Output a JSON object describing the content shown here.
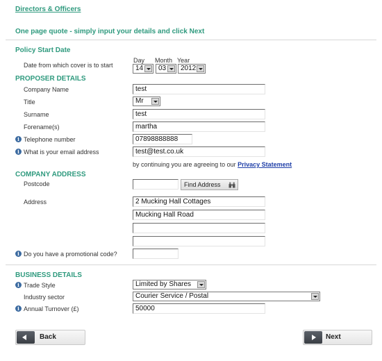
{
  "header": {
    "breadcrumb_link": "Directors & Officers",
    "intro": "One page quote - simply input your details and click Next"
  },
  "policy": {
    "section_title": "Policy Start Date",
    "date_label": "Date from which cover is to start",
    "day_header": "Day",
    "month_header": "Month",
    "year_header": "Year",
    "day_value": "14",
    "month_value": "03",
    "year_value": "2012"
  },
  "proposer": {
    "section_title": "PROPOSER DETAILS",
    "company_label": "Company Name",
    "company_value": "test",
    "title_label": "Title",
    "title_value": "Mr",
    "surname_label": "Surname",
    "surname_value": "test",
    "forename_label": "Forename(s)",
    "forename_value": "martha",
    "phone_label": "Telephone number",
    "phone_value": "07898888888",
    "email_label": "What is your email address",
    "email_value": "test@test.co.uk",
    "consent_text": "by continuing you are agreeing to our",
    "privacy_link": "Privacy Statement"
  },
  "address": {
    "section_title": "COMPANY ADDRESS",
    "postcode_label": "Postcode",
    "postcode_value": "",
    "find_button": "Find Address",
    "address_label": "Address",
    "line1": "2 Mucking Hall Cottages",
    "line2": "Mucking Hall Road",
    "line3": "",
    "line4": "",
    "promo_label": "Do you have a promotional code?",
    "promo_value": ""
  },
  "business": {
    "section_title": "BUSINESS DETAILS",
    "trade_label": "Trade Style",
    "trade_value": "Limited by Shares",
    "industry_label": "Industry sector",
    "industry_value": "Courier Service / Postal",
    "turnover_label": "Annual Turnover (£)",
    "turnover_value": "50000"
  },
  "nav": {
    "back_label": "Back",
    "next_label": "Next"
  },
  "icons": {
    "info": "info-icon",
    "binoculars": "binoculars-icon",
    "back_arrow": "arrow-left-icon",
    "next_arrow": "arrow-right-icon"
  },
  "colors": {
    "accent": "#2f9a7e",
    "info_icon": "#3b6aa0"
  }
}
